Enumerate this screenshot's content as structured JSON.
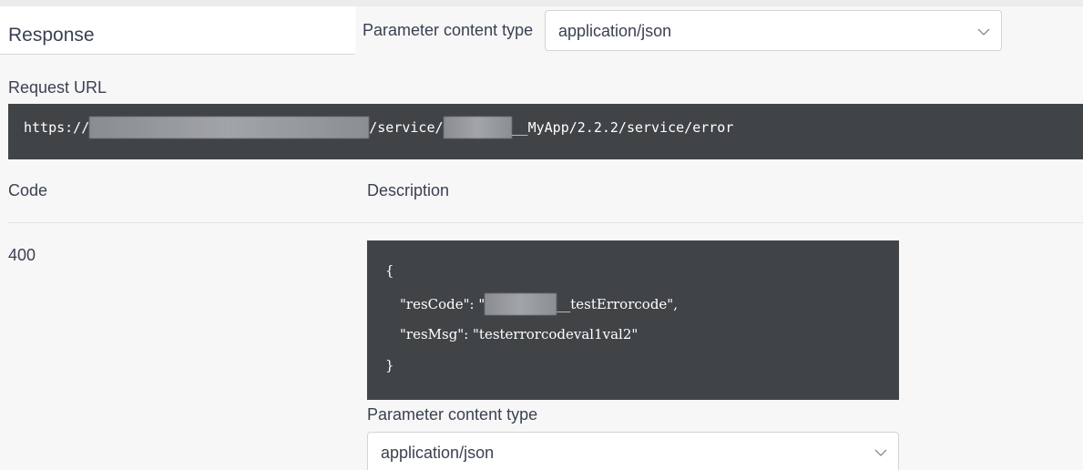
{
  "response": {
    "title": "Response",
    "content_type_label": "Parameter content type",
    "content_type_value": "application/json"
  },
  "request_url": {
    "label": "Request URL",
    "prefix": "https://",
    "segment1": "/service/",
    "segment2": "__MyApp/2.2.2/service/error"
  },
  "table": {
    "code_header": "Code",
    "description_header": "Description",
    "rows": [
      {
        "code": "400",
        "json_open": "{",
        "res_code_key": "\"resCode\": \"",
        "res_code_suffix": "__testErrorcode\",",
        "res_msg_line": "\"resMsg\": \"testerrorcodeval1val2\"",
        "json_close": "}",
        "content_type_label": "Parameter content type",
        "content_type_value": "application/json"
      }
    ]
  },
  "icons": {
    "select_chevron": "chevron-down-icon"
  }
}
